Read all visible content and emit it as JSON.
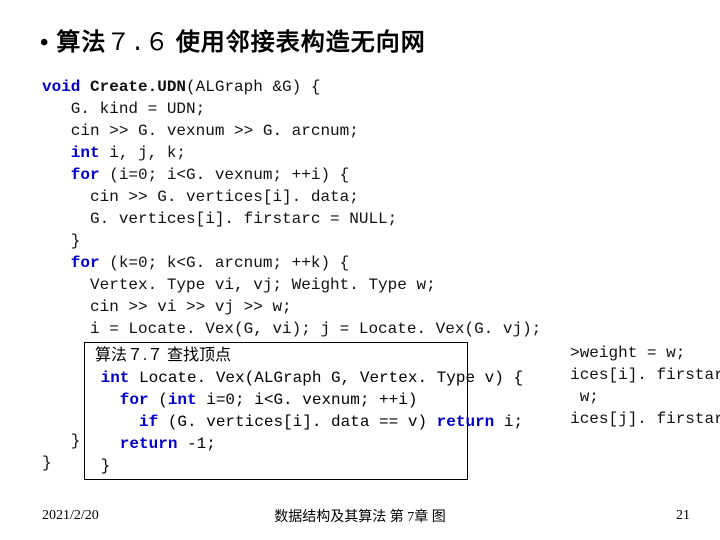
{
  "title": {
    "bullet": "•",
    "prefix": "算法",
    "num": "７.６",
    "rest": " 使用邻接表构造无向网"
  },
  "code": {
    "l0a": "void",
    "l0b": " Create.UDN",
    "l0c": "(ALGraph &G) {",
    "l1": "   G. kind = UDN;",
    "l2": "   cin >> G. vexnum >> G. arcnum;",
    "l3a": "   int",
    "l3b": " i, j, k;",
    "l4a": "   for",
    "l4b": " (i=0; i<G. vexnum; ++i) {",
    "l5": "     cin >> G. vertices[i]. data;",
    "l6": "     G. vertices[i]. firstarc = NULL;",
    "l7": "   }",
    "l8a": "   for",
    "l8b": " (k=0; k<G. arcnum; ++k) {",
    "l9": "     Vertex. Type vi, vj; Weight. Type w;",
    "l10": "     cin >> vi >> vj >> w;",
    "l11": "     i = Locate. Vex(G, vi); j = Locate. Vex(G. vj);"
  },
  "bg": {
    "b1": "                                                       >weight = w;",
    "b2": "                                                       ices[i]. firstarc = p;",
    "b3": "                                                        w;",
    "b4": "                                                       ices[j]. firstarc = p;",
    "b5": "   }",
    "b6": "}"
  },
  "overlay": {
    "caption": " 算法７.７ 查找顶点",
    "r0a": " int",
    "r0b": " Locate. Vex(ALGraph G, Vertex. Type v) {",
    "r1a": "   for",
    "r1b": " (",
    "r1c": "int",
    "r1d": " i=0; i<G. vexnum; ++i)",
    "r2a": "     if",
    "r2b": " (G. vertices[i]. data == v) ",
    "r2c": "return",
    "r2d": " i;",
    "r3a": "   return",
    "r3b": " -1;",
    "r4": " }"
  },
  "footer": {
    "date": "2021/2/20",
    "center": "数据结构及其算法  第 7章  图",
    "page": "21"
  }
}
